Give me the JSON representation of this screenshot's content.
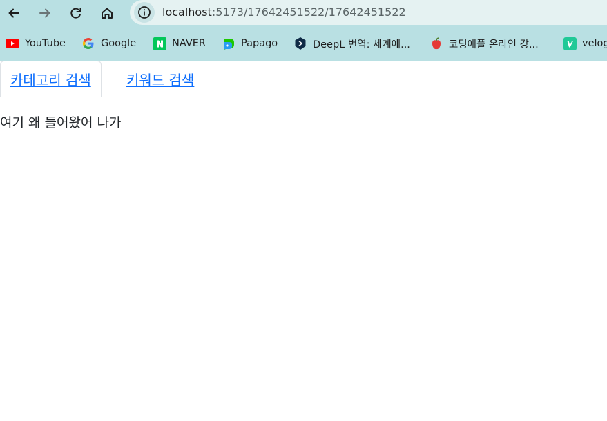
{
  "browser": {
    "url_host": "localhost",
    "url_path": ":5173/17642451522/17642451522",
    "nav": {
      "back": "back-arrow",
      "forward": "forward-arrow",
      "reload": "reload",
      "home": "home"
    }
  },
  "bookmarks": [
    {
      "label": "YouTube",
      "icon": "youtube-icon",
      "color": "#ff0000"
    },
    {
      "label": "Google",
      "icon": "google-icon",
      "color": "#4285f4"
    },
    {
      "label": "NAVER",
      "icon": "naver-icon",
      "color": "#03c75a"
    },
    {
      "label": "Papago",
      "icon": "papago-icon",
      "color": "#1ec800"
    },
    {
      "label": "DeepL 번역: 세계에...",
      "icon": "deepl-icon",
      "color": "#0f2b46"
    },
    {
      "label": "코딩애플 온라인 강...",
      "icon": "apple-icon",
      "color": "#e53935"
    },
    {
      "label": "velog",
      "icon": "velog-icon",
      "color": "#20c997"
    }
  ],
  "tabs": [
    {
      "label": "카테고리 검색",
      "active": true
    },
    {
      "label": "키워드 검색",
      "active": false
    }
  ],
  "content": {
    "message": "여기 왜 들어왔어 나가"
  }
}
